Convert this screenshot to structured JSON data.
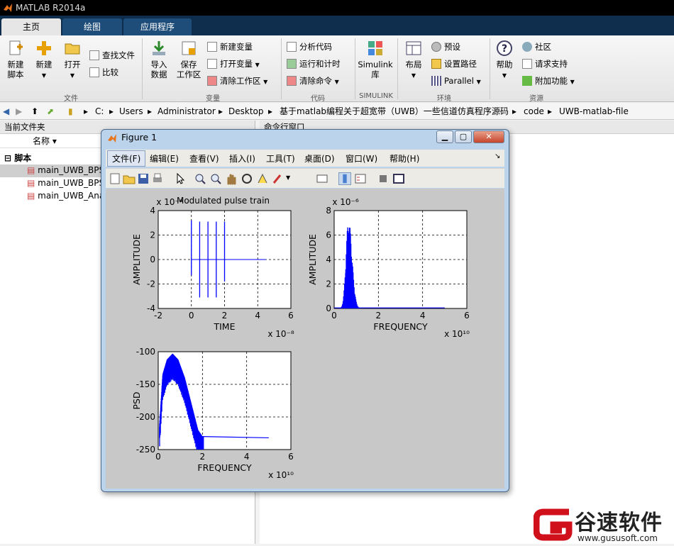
{
  "app": {
    "title": "MATLAB R2014a"
  },
  "tabs": [
    {
      "label": "主页"
    },
    {
      "label": "绘图"
    },
    {
      "label": "应用程序"
    }
  ],
  "ribbon": {
    "file": {
      "new_script": "新建\n脚本",
      "new": "新建",
      "open": "打开",
      "find_files": "查找文件",
      "compare": "比较",
      "section": "文件"
    },
    "variable": {
      "import": "导入\n数据",
      "save_ws": "保存\n工作区",
      "new_var": "新建变量",
      "open_var": "打开变量",
      "clear_ws": "清除工作区",
      "section": "变量"
    },
    "code": {
      "analyze": "分析代码",
      "run_time": "运行和计时",
      "clear_cmd": "清除命令",
      "section": "代码"
    },
    "simulink": {
      "lib": "Simulink\n库",
      "section": "SIMULINK"
    },
    "env": {
      "layout": "布局",
      "prefs": "预设",
      "set_path": "设置路径",
      "parallel": "Parallel",
      "section": "环境"
    },
    "resources": {
      "help": "帮助",
      "community": "社区",
      "support": "请求支持",
      "addons": "附加功能",
      "section": "资源"
    }
  },
  "address": [
    "C:",
    "Users",
    "Administrator",
    "Desktop",
    "基于matlab编程关于超宽带（UWB）一些信道仿真程序源码",
    "code",
    "UWB-matlab-file"
  ],
  "left_panel": {
    "title": "当前文件夹",
    "col_name": "名称",
    "group": "脚本",
    "files": [
      "main_UWB_BPS",
      "main_UWB_BPS",
      "main_UWB_Ana"
    ]
  },
  "cmd_panel": {
    "title": "命令行窗口"
  },
  "figure": {
    "title": "Figure 1",
    "menus": [
      "文件(F)",
      "编辑(E)",
      "查看(V)",
      "插入(I)",
      "工具(T)",
      "桌面(D)",
      "窗口(W)",
      "帮助(H)"
    ]
  },
  "chart_data": [
    {
      "type": "line",
      "title": "Modulated pulse train",
      "xlabel": "TIME",
      "ylabel": "AMPLITUDE",
      "x_exponent": "x 10⁻⁸",
      "y_exponent": "x 10⁻⁴",
      "xlim": [
        -2,
        6
      ],
      "ylim": [
        -4,
        4
      ],
      "xticks": [
        "-2",
        "0",
        "2",
        "4",
        "6"
      ],
      "yticks": [
        "4",
        "2",
        "0",
        "-2",
        "-4"
      ],
      "spikes": [
        {
          "x": 0.0,
          "min": -1.3,
          "max": 3.2
        },
        {
          "x": 0.5,
          "min": -3.1,
          "max": 3.1
        },
        {
          "x": 1.0,
          "min": -3.1,
          "max": 3.1
        },
        {
          "x": 1.5,
          "min": -3.1,
          "max": 3.1
        },
        {
          "x": 2.0,
          "min": -1.8,
          "max": 3.1
        }
      ],
      "baseline_end": 4.5
    },
    {
      "type": "area",
      "xlabel": "FREQUENCY",
      "ylabel": "AMPLITUDE",
      "x_exponent": "x 10¹⁰",
      "y_exponent": "x 10⁻⁶",
      "xlim": [
        0,
        6
      ],
      "ylim": [
        0,
        8
      ],
      "xticks": [
        "0",
        "2",
        "4",
        "6"
      ],
      "yticks": [
        "8",
        "6",
        "4",
        "2",
        "0"
      ],
      "peak_x": 0.65,
      "peak_y": 7.2,
      "tail_end": 5.0
    },
    {
      "type": "line",
      "xlabel": "FREQUENCY",
      "ylabel": "PSD",
      "x_exponent": "x 10¹⁰",
      "xlim": [
        0,
        6
      ],
      "ylim": [
        -250,
        -100
      ],
      "xticks": [
        "0",
        "2",
        "4",
        "6"
      ],
      "yticks": [
        "-100",
        "-150",
        "-200",
        "-250"
      ],
      "envelope": [
        [
          0.05,
          -215
        ],
        [
          0.2,
          -135
        ],
        [
          0.4,
          -112
        ],
        [
          0.65,
          -103
        ],
        [
          0.9,
          -112
        ],
        [
          1.2,
          -140
        ],
        [
          1.5,
          -180
        ],
        [
          1.8,
          -220
        ],
        [
          2.0,
          -230
        ],
        [
          5.0,
          -232
        ]
      ]
    }
  ],
  "watermark": {
    "brand": "谷速软件",
    "url": "www.gususoft.com"
  }
}
